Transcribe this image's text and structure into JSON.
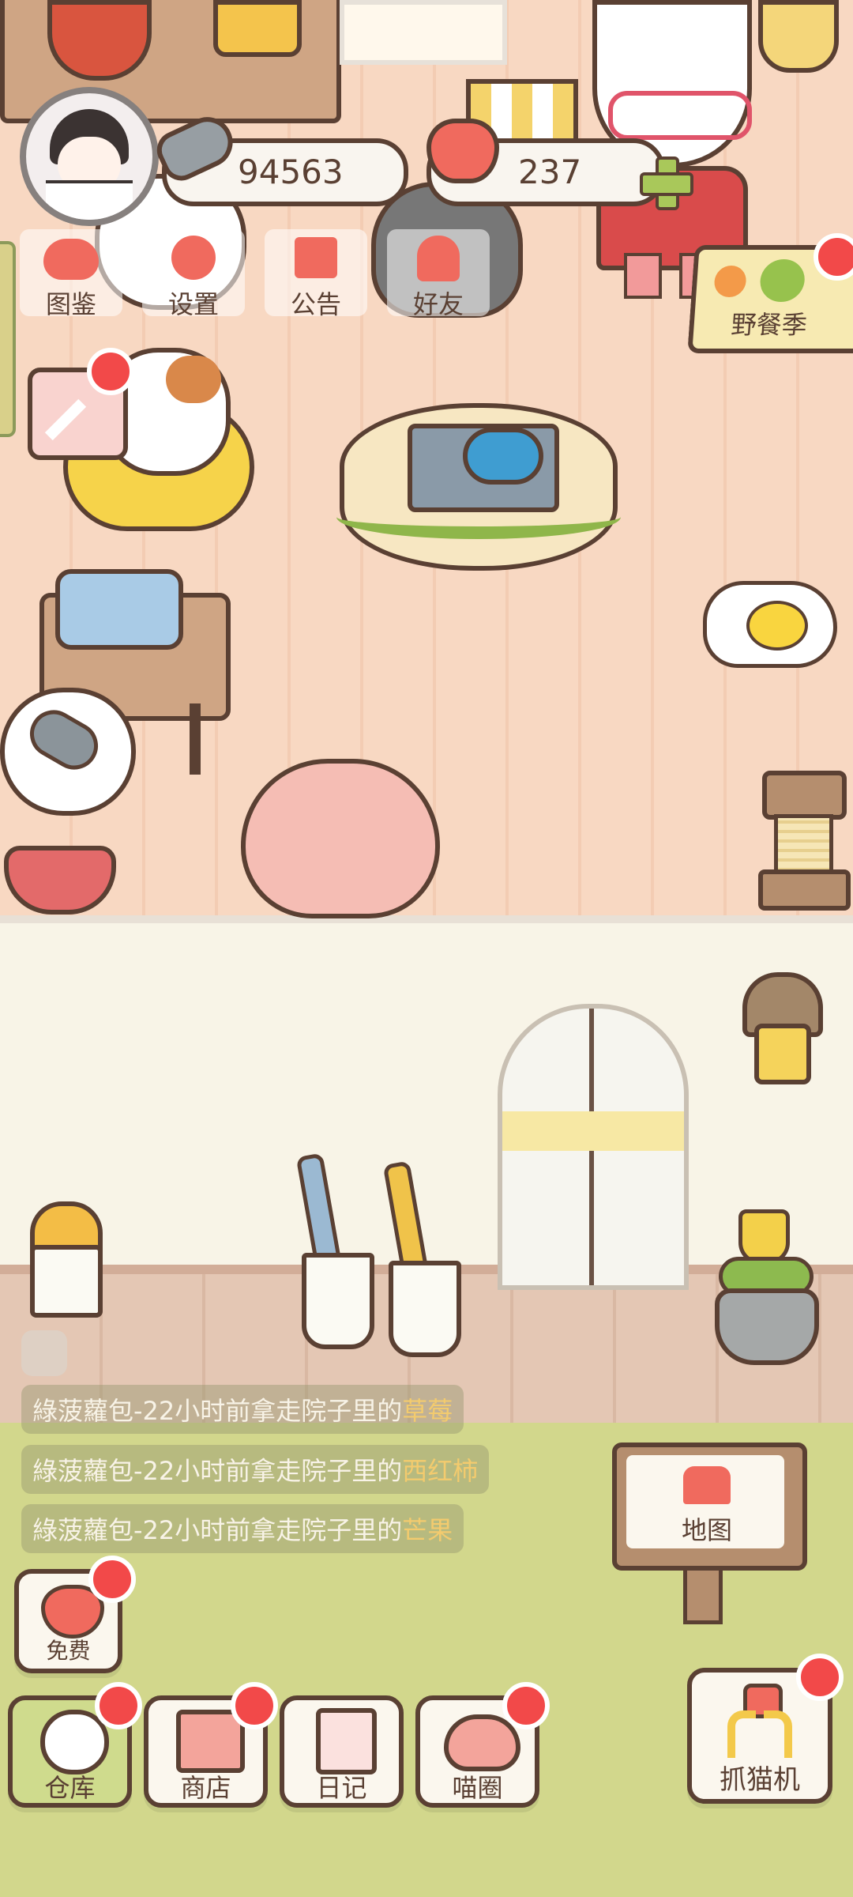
{
  "hud": {
    "fish_currency": "94563",
    "heart_currency": "237"
  },
  "top_menu": [
    {
      "label": "图鉴",
      "icon": "cat-head-icon"
    },
    {
      "label": "设置",
      "icon": "gear-icon"
    },
    {
      "label": "公告",
      "icon": "gift-icon"
    },
    {
      "label": "好友",
      "icon": "friends-icon"
    }
  ],
  "event_banner": {
    "label": "野餐季"
  },
  "log_messages": [
    {
      "prefix": "綠菠蘿包-22小时前拿走院子里的",
      "item": "草莓"
    },
    {
      "prefix": "綠菠蘿包-22小时前拿走院子里的",
      "item": "西红柿"
    },
    {
      "prefix": "綠菠蘿包-22小时前拿走院子里的",
      "item": "芒果"
    }
  ],
  "map_sign": {
    "label": "地图"
  },
  "free_button": {
    "label": "免费"
  },
  "bottom_nav": [
    {
      "label": "仓库",
      "icon": "bowl-icon"
    },
    {
      "label": "商店",
      "icon": "shop-icon"
    },
    {
      "label": "日记",
      "icon": "diary-icon"
    },
    {
      "label": "喵圈",
      "icon": "planet-cat-icon"
    }
  ],
  "catch_button": {
    "label": "抓猫机"
  },
  "colors": {
    "accent": "#f06a5e",
    "badge": "#f24949",
    "outline": "#5a4033",
    "yard": "#d2d78c"
  }
}
